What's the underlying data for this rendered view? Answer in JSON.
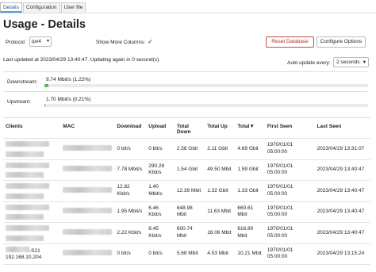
{
  "tabs": [
    "Details",
    "Configuration",
    "User file"
  ],
  "title": "Usage - Details",
  "protocol": {
    "label": "Protocol:",
    "value": "ipv4"
  },
  "show_more": {
    "label": "Show More Columns:",
    "checked": true
  },
  "buttons": {
    "reset": "Reset Database",
    "config": "Configure Options"
  },
  "last_updated": "Last updated at 2023/04/29 13:40:47.  Updating again in 0 second(s).",
  "auto_update": {
    "label": "Auto update every:",
    "value": "2 seconds"
  },
  "downstream": {
    "label": "Downstream:",
    "value": "9.74 Mbit/s (1.22%)",
    "fraction": 0.0122
  },
  "upstream": {
    "label": "Upstream:",
    "value": "1.70 Mbit/s (0.21%)",
    "fraction": 0.0021
  },
  "colors": {
    "bar": "#5cb85c",
    "reset": "#c9493a",
    "tab_accent": "#5a9bd5"
  },
  "table": {
    "headers": [
      "Clients",
      "MAC",
      "Download",
      "Upload",
      "Total Down",
      "Total Up",
      "Total▼",
      "First Seen",
      "Last Seen"
    ],
    "rows": [
      {
        "client": "",
        "client_ip": "",
        "download": "0 bit/s",
        "upload": "0 bit/s",
        "total_down": "2.58 Gbit",
        "total_up": "2.11 Gbit",
        "total": "4.69 Gbit",
        "first_seen": "1970/01/01 05:00:00",
        "last_seen": "2023/04/29 13:31:07"
      },
      {
        "client": "",
        "client_ip": "",
        "download": "7.78 Mbit/s",
        "upload": "290.28 Kbit/s",
        "total_down": "1.54 Gbit",
        "total_up": "49.50 Mbit",
        "total": "1.59 Gbit",
        "first_seen": "1970/01/01 05:00:00",
        "last_seen": "2023/04/29 13:40:47"
      },
      {
        "client": "",
        "client_ip": "",
        "download": "12.82 Kbit/s",
        "upload": "1.40 Mbit/s",
        "total_down": "12.39 Mbit",
        "total_up": "1.32 Gbit",
        "total": "1.33 Gbit",
        "first_seen": "1970/01/01 05:00:00",
        "last_seen": "2023/04/29 13:40:47"
      },
      {
        "client": "",
        "client_ip": "",
        "download": "1.95 Mbit/s",
        "upload": "6.46 Kbit/s",
        "total_down": "648.98 Mbit",
        "total_up": "11.63 Mbit",
        "total": "660.61 Mbit",
        "first_seen": "1970/01/01 05:00:00",
        "last_seen": "2023/04/29 13:40:47"
      },
      {
        "client": "",
        "client_ip": "",
        "download": "2.22 Kbit/s",
        "upload": "8.45 Kbit/s",
        "total_down": "600.74 Mbit",
        "total_up": "16.06 Mbit",
        "total": "616.80 Mbit",
        "first_seen": "1970/01/01 05:00:00",
        "last_seen": "2023/04/29 13:40:47"
      },
      {
        "client": "-S21",
        "client_ip": "192.168.10.204",
        "download": "0 bit/s",
        "upload": "0 bit/s",
        "total_down": "5.68 Mbit",
        "total_up": "4.53 Mbit",
        "total": "10.21 Mbit",
        "first_seen": "1970/01/01 05:00:00",
        "last_seen": "2023/04/29 13:15:24"
      }
    ]
  }
}
